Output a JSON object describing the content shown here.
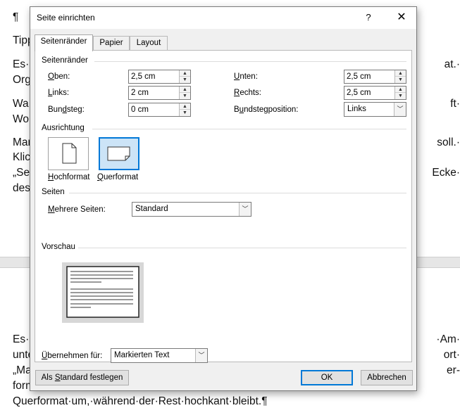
{
  "document": {
    "top_lines": [
      {
        "left": "¶",
        "right": ""
      },
      {
        "left": "Tipp",
        "right": ""
      },
      {
        "left": "Es·",
        "right": "at.·"
      },
      {
        "left": "Org",
        "right": ""
      },
      {
        "left": "Wa",
        "right": "ft·"
      },
      {
        "left": "Wo",
        "right": ""
      },
      {
        "left": "Mar",
        "right": "soll.·"
      },
      {
        "left": "Klic",
        "right": ""
      },
      {
        "left": "„Se",
        "right": "Ecke·"
      },
      {
        "left": "des",
        "right": ""
      }
    ],
    "bottom_lines": [
      {
        "left": "Es·",
        "right": "·Am·"
      },
      {
        "left": "unte",
        "right": "ort·"
      },
      {
        "left": "„Ma",
        "right": "er-"
      },
      {
        "left": "form",
        "right": ""
      },
      {
        "left": "Querformat·um,·während·der·Rest·hochkant·bleibt.¶",
        "right": ""
      }
    ]
  },
  "dialog": {
    "title": "Seite einrichten",
    "help": "?",
    "close": "✕",
    "tabs": [
      {
        "label": "Seitenränder",
        "active": true
      },
      {
        "label": "Papier",
        "active": false
      },
      {
        "label": "Layout",
        "active": false
      }
    ],
    "margins": {
      "group_title": "Seitenränder",
      "oben_label_u": "O",
      "oben_label_rest": "ben:",
      "oben_value": "2,5 cm",
      "links_label_u": "L",
      "links_label_rest": "inks:",
      "links_value": "2 cm",
      "bundsteg_label_pre": "Bun",
      "bundsteg_label_u": "d",
      "bundsteg_label_rest": "steg:",
      "bundsteg_value": "0 cm",
      "unten_label_u": "U",
      "unten_label_rest": "nten:",
      "unten_value": "2,5 cm",
      "rechts_label_u": "R",
      "rechts_label_rest": "echts:",
      "rechts_value": "2,5 cm",
      "bundstegpos_label_pre": "B",
      "bundstegpos_label_u": "u",
      "bundstegpos_label_rest": "ndstegposition:",
      "bundstegpos_value": "Links"
    },
    "orientation": {
      "group_title": "Ausrichtung",
      "portrait_label_u": "H",
      "portrait_label_rest": "ochformat",
      "landscape_label_u": "Q",
      "landscape_label_rest": "uerformat",
      "selected": "landscape"
    },
    "pages": {
      "group_title": "Seiten",
      "multiple_label_pre": "",
      "multiple_label_u": "M",
      "multiple_label_rest": "ehrere Seiten:",
      "multiple_value": "Standard"
    },
    "preview": {
      "group_title": "Vorschau"
    },
    "apply": {
      "label_pre": "",
      "label_u": "Ü",
      "label_rest": "bernehmen für:",
      "value": "Markierten Text"
    },
    "buttons": {
      "default_pre": "Als ",
      "default_u": "S",
      "default_rest": "tandard festlegen",
      "ok": "OK",
      "cancel": "Abbrechen"
    },
    "colors": {
      "accent": "#0078d7",
      "selected_fill": "#cce4f7"
    }
  }
}
